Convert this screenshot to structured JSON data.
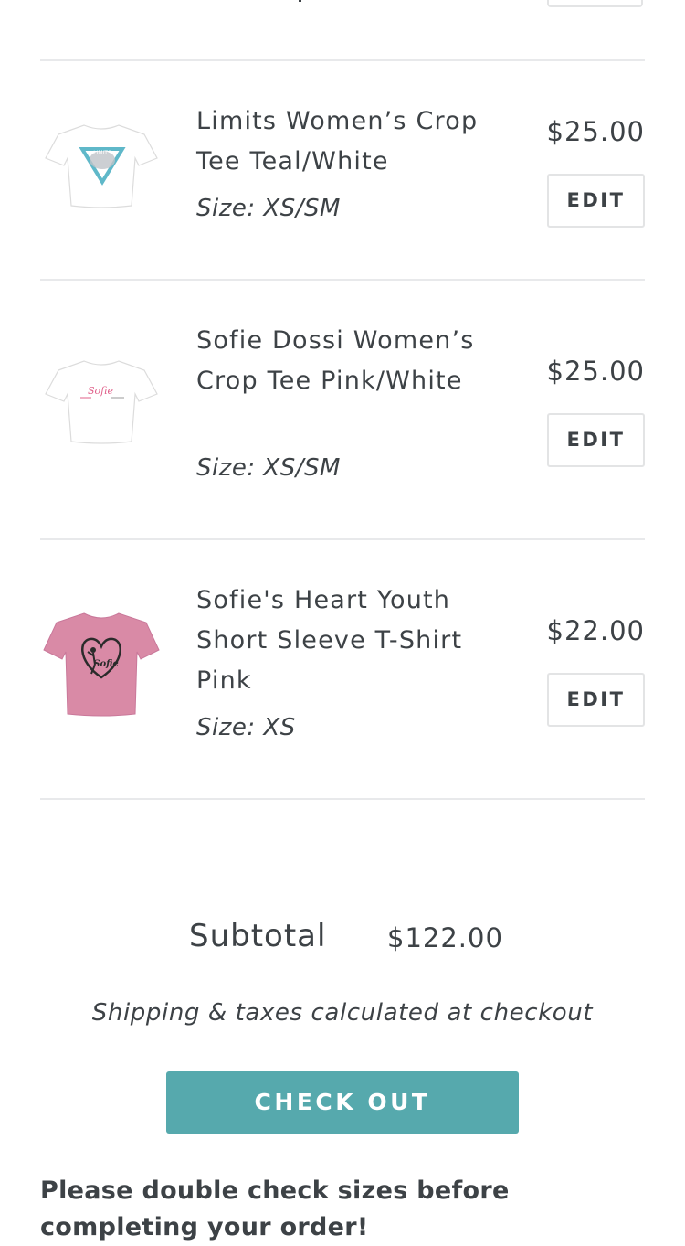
{
  "cart": {
    "items": [
      {
        "title": "Limits Women’s Crop Tee Teal/White",
        "size": "Size: XS/SM",
        "price": "$25.00",
        "edit_label": "EDIT",
        "thumb_text": "LIMITS",
        "thumb_color": "#ffffff",
        "thumb_accent": "#5fb8c9"
      },
      {
        "title": "Sofie Dossi Women’s Crop Tee Pink/White",
        "size": "Size: XS/SM",
        "price": "$25.00",
        "edit_label": "EDIT",
        "thumb_text": "Sofie",
        "thumb_color": "#ffffff",
        "thumb_accent": "#e0608a"
      },
      {
        "title": "Sofie's Heart Youth Short Sleeve T-Shirt Pink",
        "size": "Size: XS",
        "price": "$22.00",
        "edit_label": "EDIT",
        "thumb_text": "Sofie",
        "thumb_color": "#d98aa6",
        "thumb_accent": "#2b2b2b"
      }
    ]
  },
  "summary": {
    "subtotal_label": "Subtotal",
    "subtotal_value": "$122.00",
    "shipping_note": "Shipping & taxes calculated at checkout",
    "checkout_label": "CHECK OUT",
    "checkout_color": "#56a9ad"
  },
  "note": {
    "text": "Please double check sizes before completing your order!"
  }
}
